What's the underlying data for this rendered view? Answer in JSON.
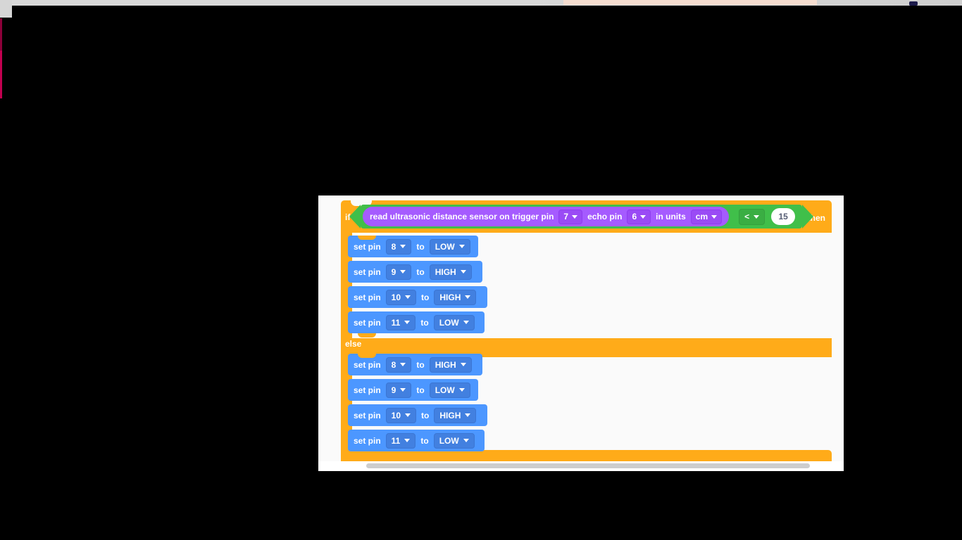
{
  "app": {
    "workspace_name": "blockly-workspace"
  },
  "program": {
    "if_label": "if",
    "then_label": "then",
    "else_label": "else",
    "condition": {
      "sensor_block": {
        "text_start": "read ultrasonic distance sensor on trigger pin",
        "trigger_pin": "7",
        "echo_label": "echo pin",
        "echo_pin": "6",
        "units_label": "in units",
        "units": "cm"
      },
      "operator": "<",
      "compare_value": "15"
    },
    "then_branch": [
      {
        "prefix": "set pin",
        "pin": "8",
        "mid": "to",
        "state": "LOW"
      },
      {
        "prefix": "set pin",
        "pin": "9",
        "mid": "to",
        "state": "HIGH"
      },
      {
        "prefix": "set pin",
        "pin": "10",
        "mid": "to",
        "state": "HIGH"
      },
      {
        "prefix": "set pin",
        "pin": "11",
        "mid": "to",
        "state": "LOW"
      }
    ],
    "else_branch": [
      {
        "prefix": "set pin",
        "pin": "8",
        "mid": "to",
        "state": "HIGH"
      },
      {
        "prefix": "set pin",
        "pin": "9",
        "mid": "to",
        "state": "LOW"
      },
      {
        "prefix": "set pin",
        "pin": "10",
        "mid": "to",
        "state": "HIGH"
      },
      {
        "prefix": "set pin",
        "pin": "11",
        "mid": "to",
        "state": "LOW"
      }
    ]
  },
  "colors": {
    "control_orange": "#ffab19",
    "operator_green": "#40bf4a",
    "sensor_purple": "#a55bff",
    "pin_blue": "#4c97ff",
    "workspace_bg": "#fafafa",
    "desktop_black": "#000000",
    "accent_magenta": "#c2004f"
  },
  "scrollbar": {
    "name": "horizontal-scrollbar"
  }
}
